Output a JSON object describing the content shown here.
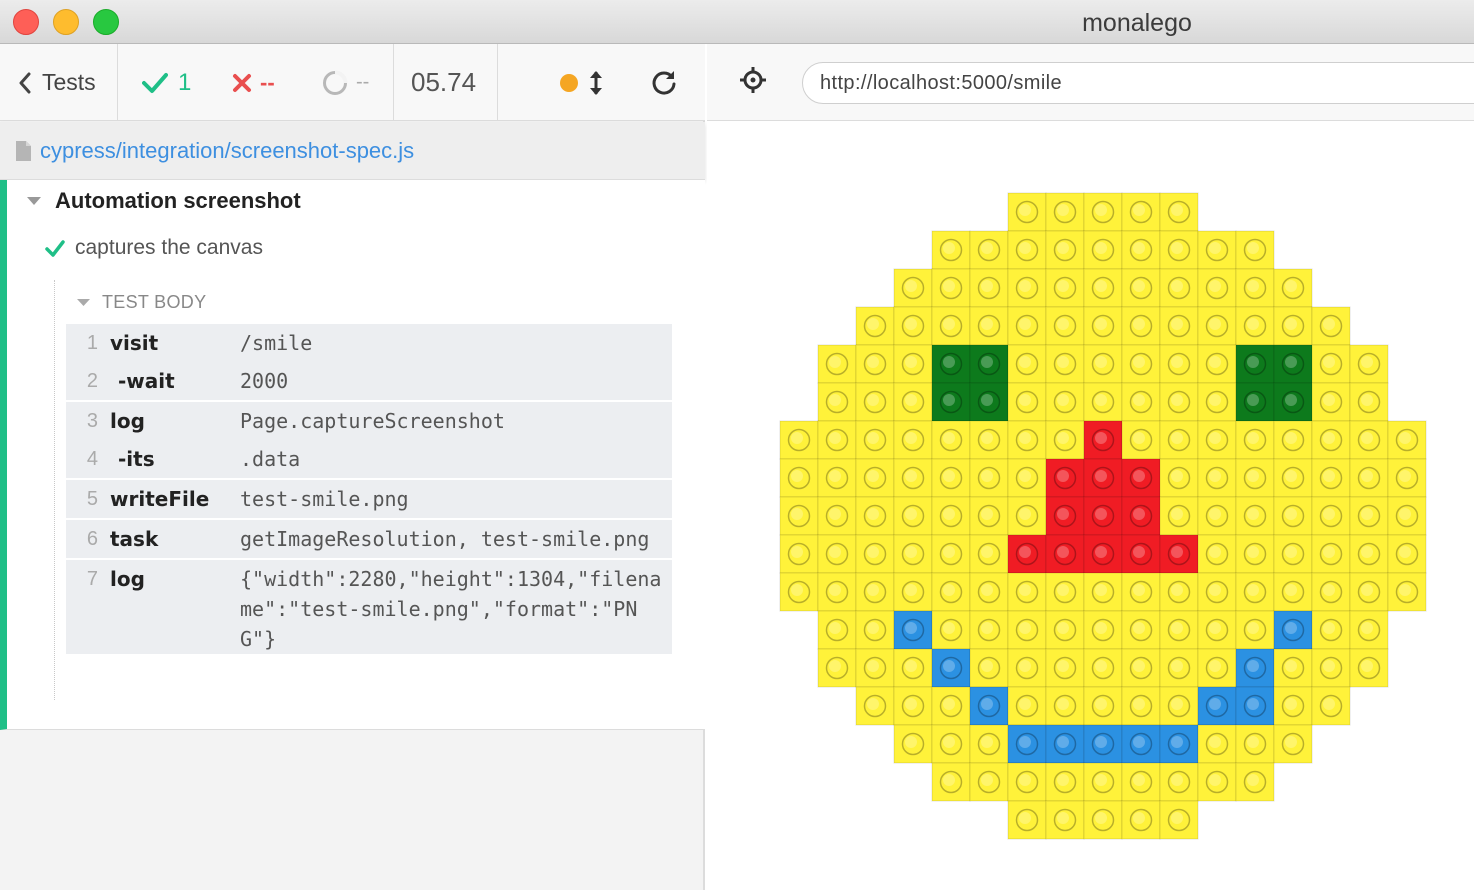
{
  "window": {
    "title": "monalego"
  },
  "toolbar": {
    "tests_label": "Tests",
    "passed": "1",
    "failed": "--",
    "pending": "--",
    "duration": "05.74"
  },
  "spec": {
    "file": "cypress/integration/screenshot-spec.js"
  },
  "suite": {
    "title": "Automation screenshot"
  },
  "test": {
    "title": "captures the canvas",
    "section": "TEST BODY"
  },
  "commands": [
    {
      "num": "1",
      "name": "visit",
      "message": "/smile"
    },
    {
      "num": "2",
      "name": "-wait",
      "message": "2000"
    },
    {
      "num": "3",
      "name": "log",
      "message": "Page.captureScreenshot"
    },
    {
      "num": "4",
      "name": "-its",
      "message": ".data"
    },
    {
      "num": "5",
      "name": "writeFile",
      "message": "test-smile.png"
    },
    {
      "num": "6",
      "name": "task",
      "message": "getImageResolution, test-smile.png"
    },
    {
      "num": "7",
      "name": "log",
      "message": "{\"width\":2280,\"height\":1304,\"filename\":\"test-smile.png\",\"format\":\"PNG\"}"
    }
  ],
  "browser": {
    "url": "http://localhost:5000/smile"
  },
  "colors": {
    "pass": "#1fbf87",
    "fail": "#e94f4f",
    "link": "#3d8fe0",
    "yellow": "#fff23a",
    "green": "#0d7a1c",
    "red": "#f01c24",
    "blue": "#2b91e2"
  },
  "lego_rows": [
    "......YYYYY......",
    "....YYYYYYYYY....",
    "...YYYYYYYYYYY...",
    "..YYYYYYYYYYYYY..",
    ".YYYGGYYYYYYGGYY.",
    ".YYYGGYYYYYYGGYY.",
    "YYYYYYYYRYYYYYYYY",
    "YYYYYYYRRRYYYYYYY",
    "YYYYYYYRRRYYYYYYY",
    "YYYYYYRRRRRYYYYYY",
    "YYYYYYYYYYYYYYYYY",
    ".YYBYYYYYYYYYBYY.",
    ".YYYBYYYYYYYBYYY.",
    "..YYYBYYYYYBBYY..",
    "...YYYBBBBBYYY...",
    "....YYYYYYYYY....",
    "......YYYYY......"
  ]
}
